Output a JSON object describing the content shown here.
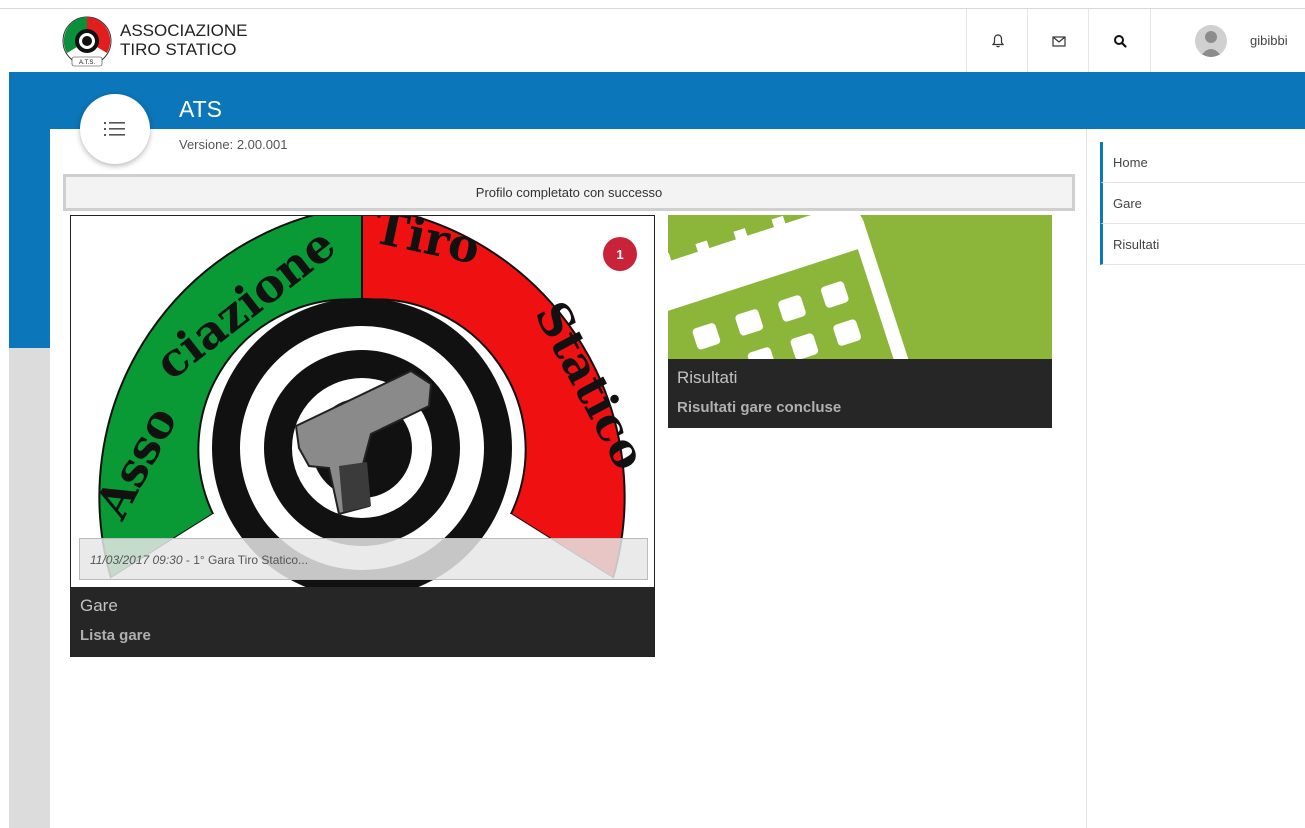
{
  "brand": {
    "line1": "ASSOCIAZIONE",
    "line2": "TIRO STATICO"
  },
  "header": {
    "icons": [
      "bell-icon",
      "envelope-icon",
      "search-icon"
    ],
    "username": "gibibbi"
  },
  "app": {
    "title": "ATS",
    "version": "Versione: 2.00.001"
  },
  "alert": {
    "message": "Profilo completato con successo"
  },
  "tiles": {
    "gare": {
      "title": "Gare",
      "subtitle": "Lista gare",
      "badge": "1",
      "event_date": "11/03/2017 09:30",
      "event_text": " - 1° Gara Tiro Statico..."
    },
    "risultati": {
      "title": "Risultati",
      "subtitle": "Risultati gare concluse"
    }
  },
  "right_nav": {
    "items": [
      {
        "label": "Home"
      },
      {
        "label": "Gare"
      },
      {
        "label": "Risultati"
      }
    ]
  },
  "colors": {
    "primary": "#0b76b9",
    "tile_green": "#8bb63a",
    "badge": "#c9233a",
    "tile_footer": "#262626"
  }
}
